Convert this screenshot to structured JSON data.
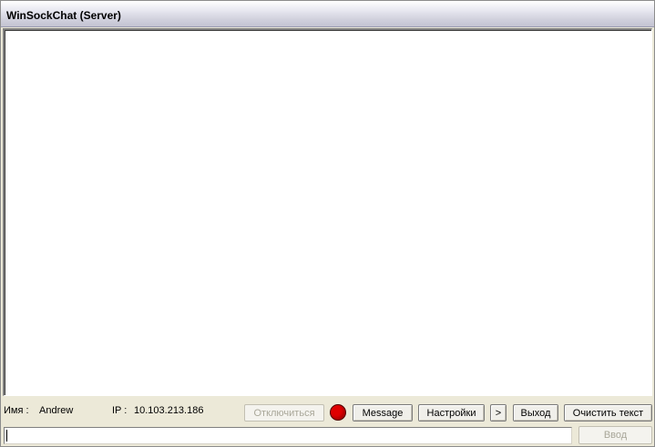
{
  "window": {
    "title": "WinSockChat (Server)"
  },
  "chat": {
    "content": ""
  },
  "status": {
    "name_label": "Имя :",
    "name_value": "Andrew",
    "ip_label": "IP :",
    "ip_value": "10.103.213.186",
    "indicator_color": "#e00000"
  },
  "toolbar": {
    "disconnect_label": "Отключиться",
    "message_label": "Message",
    "settings_label": "Настройки",
    "more_label": ">",
    "exit_label": "Выход",
    "clear_label": "Очистить текст"
  },
  "input": {
    "value": "",
    "send_label": "Ввод"
  }
}
